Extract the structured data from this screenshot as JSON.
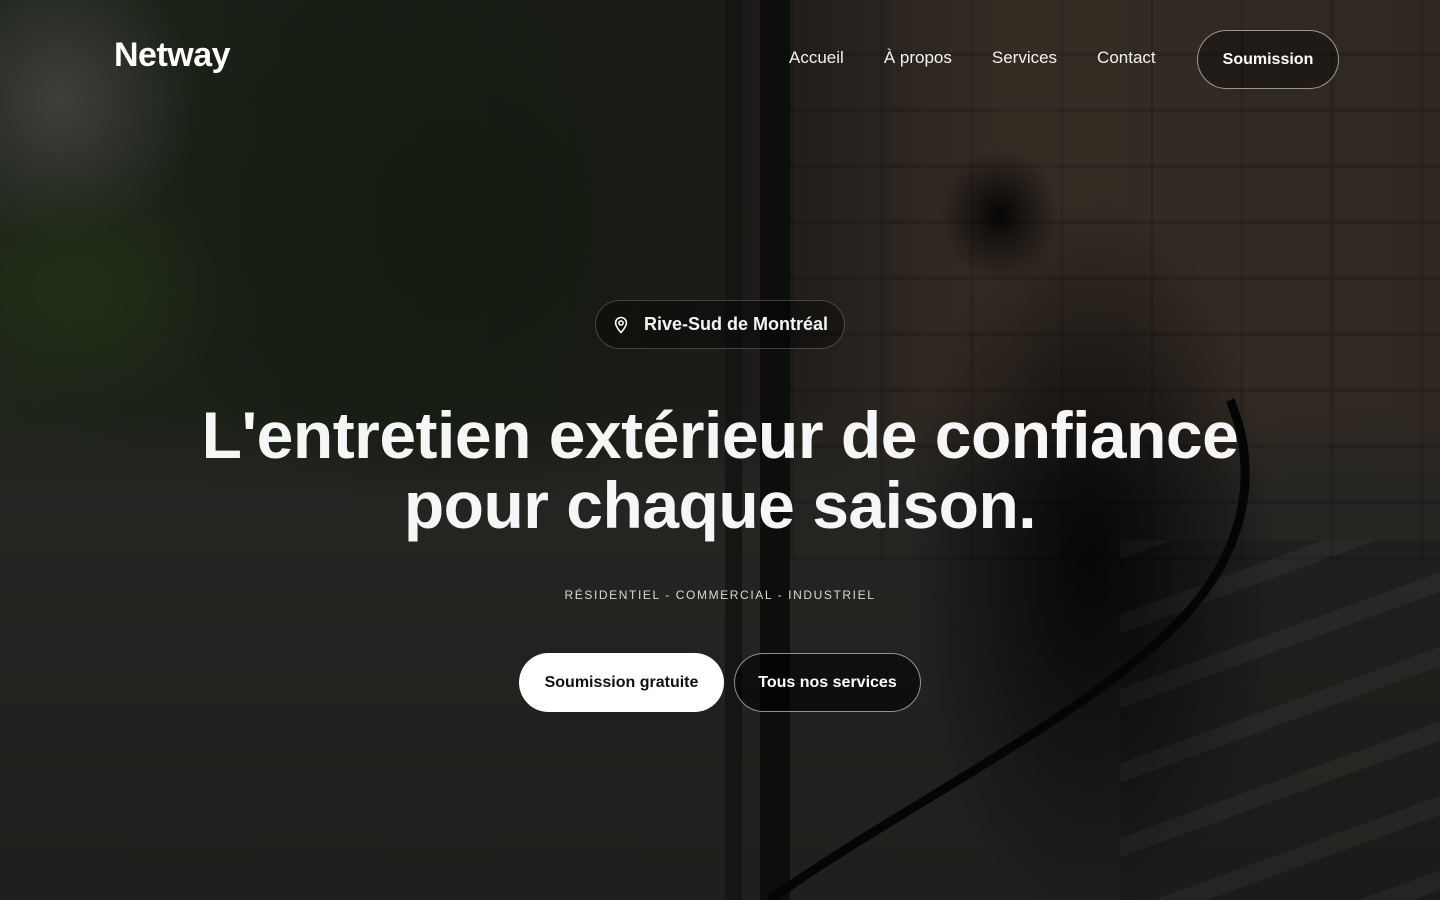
{
  "header": {
    "logo": "Netway",
    "nav": [
      {
        "label": "Accueil"
      },
      {
        "label": "À propos"
      },
      {
        "label": "Services"
      },
      {
        "label": "Contact"
      }
    ],
    "cta_label": "Soumission"
  },
  "hero": {
    "location": {
      "icon": "map-pin-icon",
      "label": "Rive-Sud de Montréal"
    },
    "headline_line1": "L'entretien extérieur de confiance",
    "headline_line2": "pour chaque saison.",
    "tagline": "RÉSIDENTIEL - COMMERCIAL - INDUSTRIEL",
    "primary_cta": "Soumission gratuite",
    "secondary_cta": "Tous nos services"
  },
  "colors": {
    "text": "#ffffff",
    "primary_button_bg": "#ffffff",
    "primary_button_text": "#111111",
    "overlay": "rgba(0,0,0,0.50)"
  }
}
